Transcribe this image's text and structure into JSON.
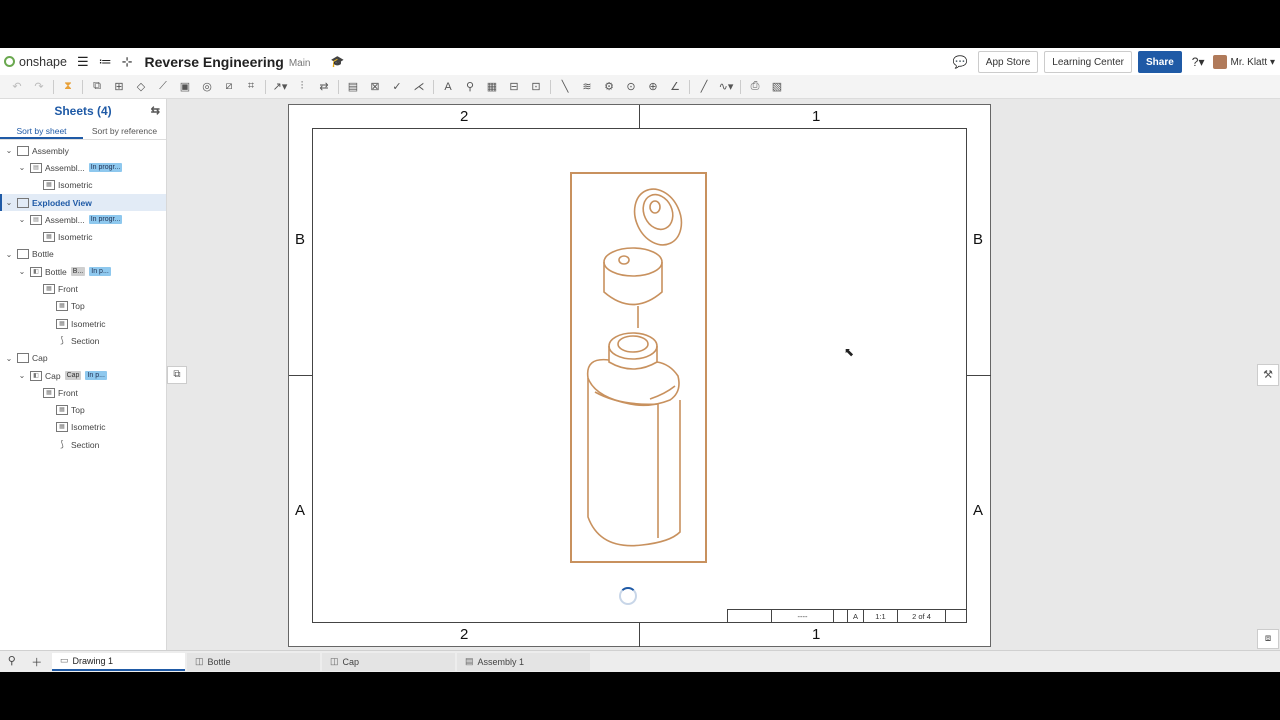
{
  "header": {
    "app_name": "onshape",
    "doc_title": "Reverse Engineering",
    "branch": "Main",
    "app_store": "App Store",
    "learning_center": "Learning Center",
    "share": "Share",
    "help": "?",
    "user": "Mr. Klatt"
  },
  "sidebar": {
    "title": "Sheets (4)",
    "tabs": [
      "Sort by sheet",
      "Sort by reference"
    ],
    "tree": [
      {
        "label": "Assembly",
        "indent": 0,
        "twisty": "open",
        "icon": "sheet"
      },
      {
        "label": "Assembl...",
        "indent": 1,
        "twisty": "open",
        "icon": "assembly",
        "badges": [
          "In progr..."
        ]
      },
      {
        "label": "Isometric",
        "indent": 2,
        "icon": "view"
      },
      {
        "label": "Exploded View",
        "indent": 0,
        "twisty": "open",
        "icon": "sheet",
        "selected": true
      },
      {
        "label": "Assembl...",
        "indent": 1,
        "twisty": "open",
        "icon": "assembly",
        "badges": [
          "In progr..."
        ]
      },
      {
        "label": "Isometric",
        "indent": 2,
        "icon": "view"
      },
      {
        "label": "Bottle",
        "indent": 0,
        "twisty": "open",
        "icon": "sheet"
      },
      {
        "label": "Bottle",
        "indent": 1,
        "twisty": "open",
        "icon": "part",
        "badges_grey": [
          "B..."
        ],
        "badges": [
          "In p..."
        ]
      },
      {
        "label": "Front",
        "indent": 2,
        "icon": "view"
      },
      {
        "label": "Top",
        "indent": 3,
        "icon": "view"
      },
      {
        "label": "Isometric",
        "indent": 3,
        "icon": "view"
      },
      {
        "label": "Section",
        "indent": 3,
        "icon": "section"
      },
      {
        "label": "Cap",
        "indent": 0,
        "twisty": "open",
        "icon": "sheet"
      },
      {
        "label": "Cap",
        "indent": 1,
        "twisty": "open",
        "icon": "part",
        "badges_grey": [
          "Cap"
        ],
        "badges": [
          "In p..."
        ]
      },
      {
        "label": "Front",
        "indent": 2,
        "icon": "view"
      },
      {
        "label": "Top",
        "indent": 3,
        "icon": "view"
      },
      {
        "label": "Isometric",
        "indent": 3,
        "icon": "view"
      },
      {
        "label": "Section",
        "indent": 3,
        "icon": "section"
      }
    ]
  },
  "sheet": {
    "zones_top": [
      "2",
      "1"
    ],
    "zones_bottom": [
      "2",
      "1"
    ],
    "zones_left": [
      "B",
      "A"
    ],
    "zones_right": [
      "B",
      "A"
    ],
    "title_block": [
      "----",
      "A",
      "1:1",
      "2 of 4"
    ],
    "drawing_color": "#c8915e"
  },
  "tabs": [
    {
      "label": "Drawing 1",
      "active": true,
      "icon": "drawing-icon"
    },
    {
      "label": "Bottle",
      "active": false,
      "icon": "part-studio-icon"
    },
    {
      "label": "Cap",
      "active": false,
      "icon": "part-studio-icon"
    },
    {
      "label": "Assembly 1",
      "active": false,
      "icon": "assembly-icon"
    }
  ]
}
